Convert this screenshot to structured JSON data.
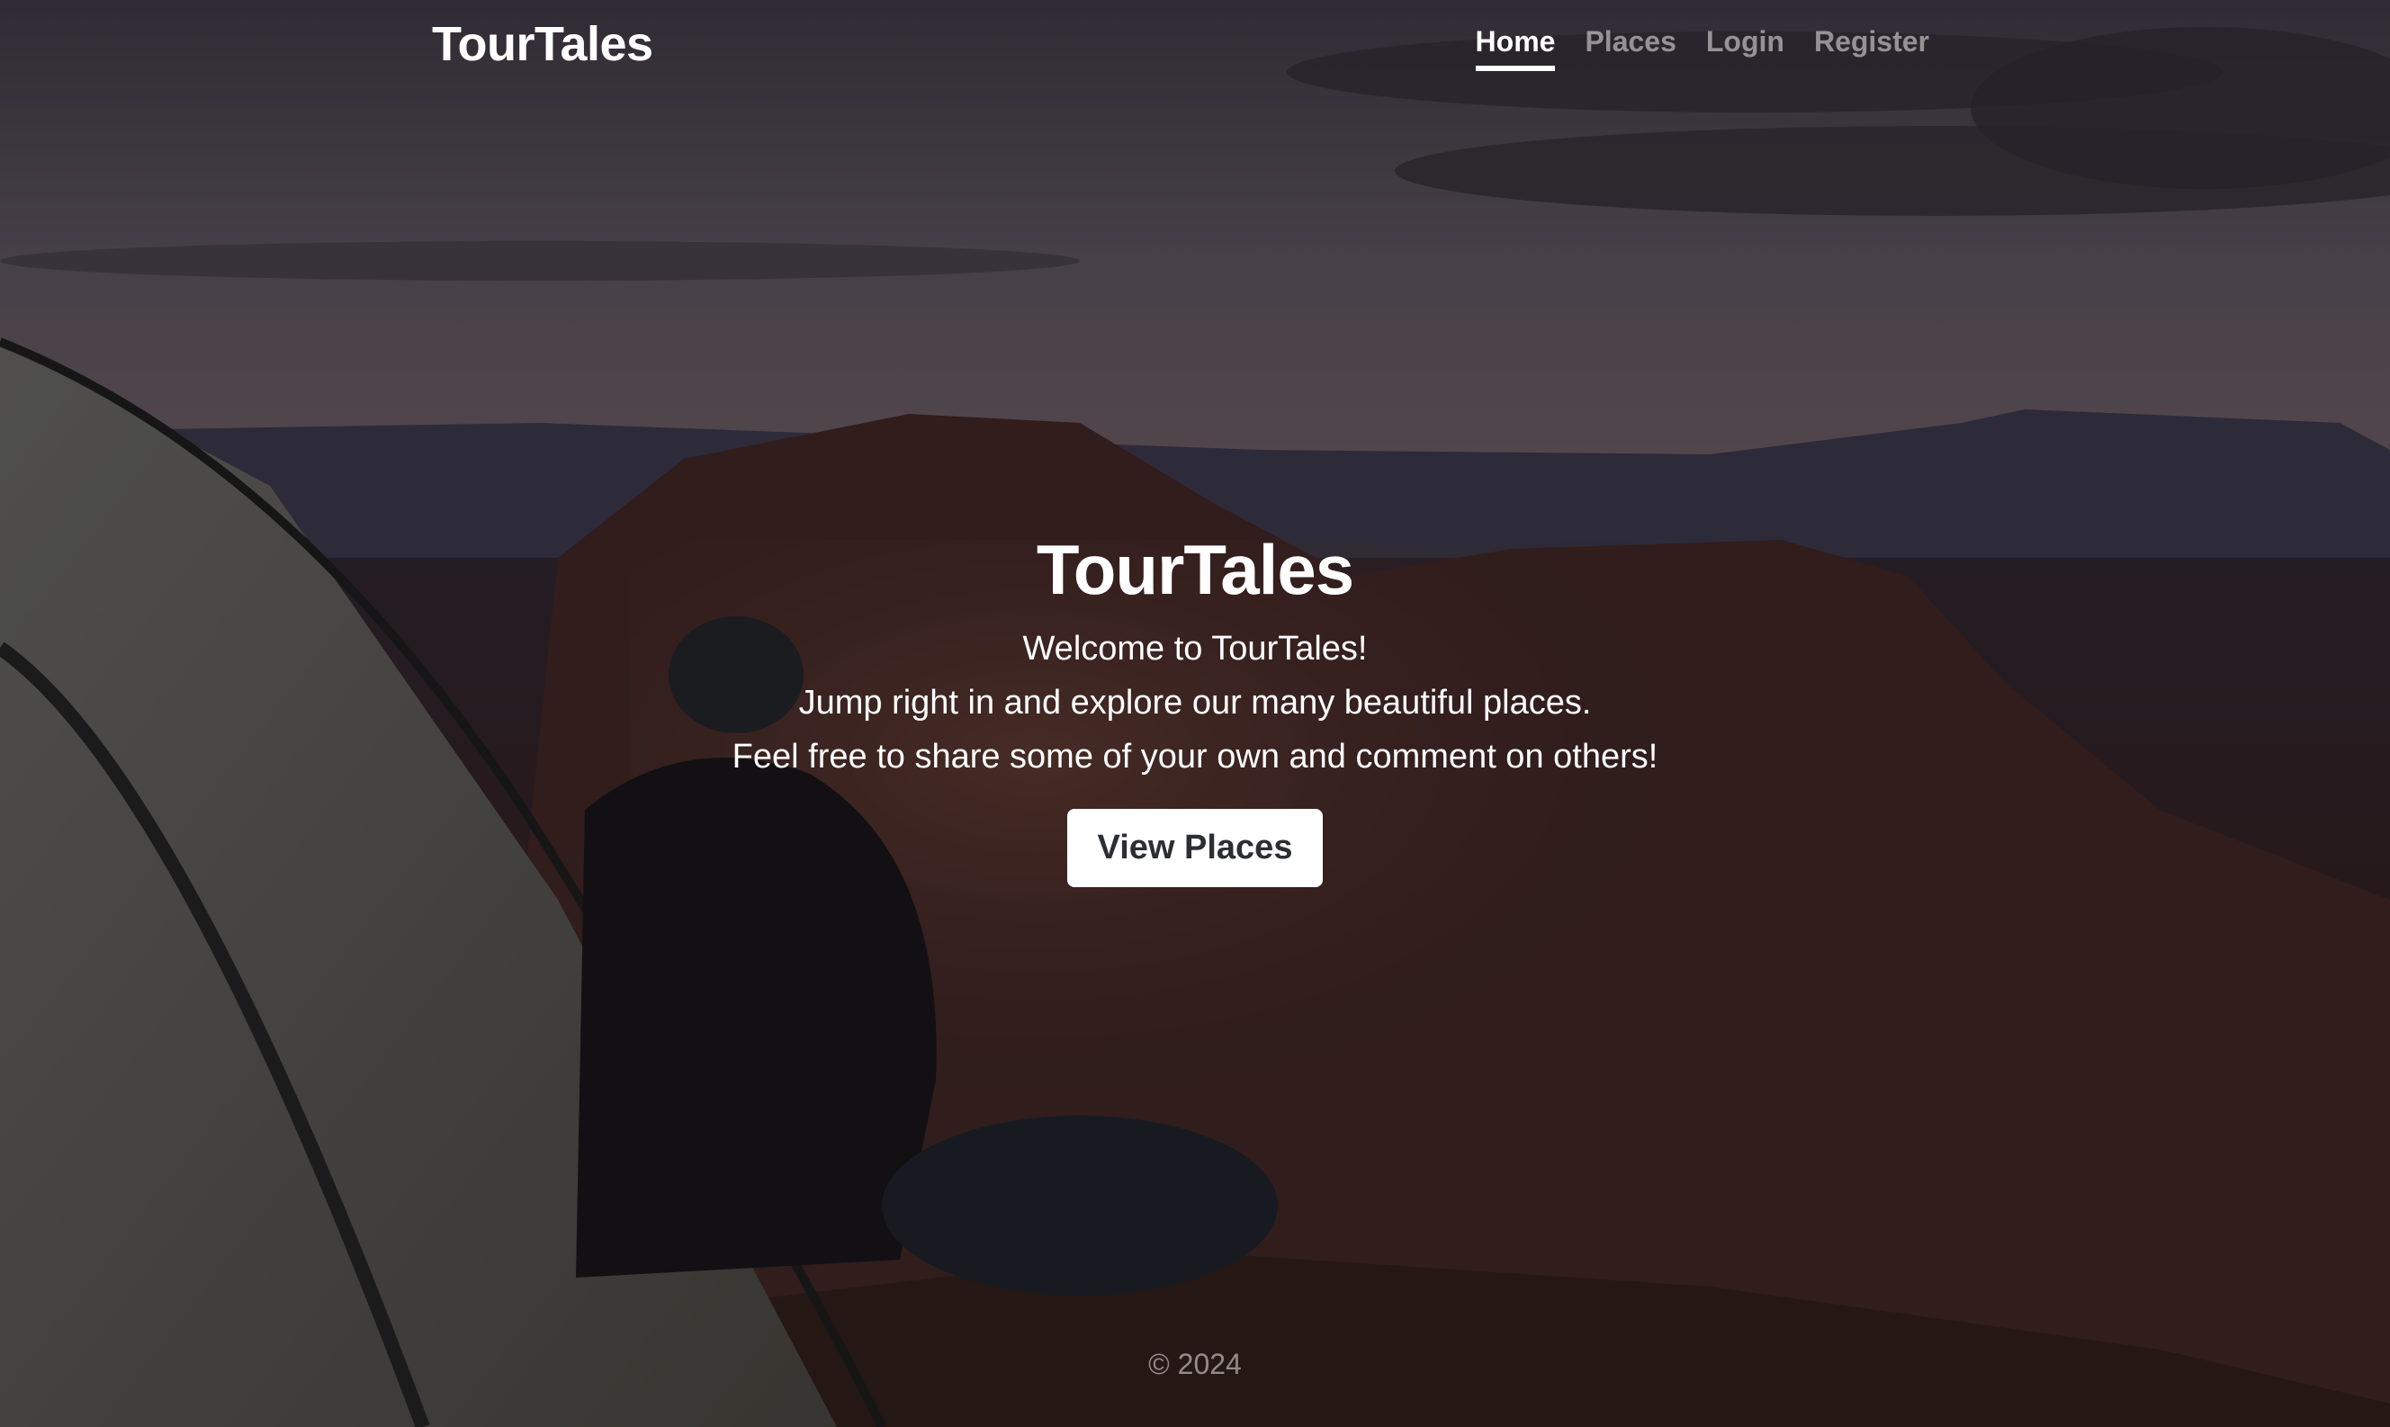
{
  "brand": {
    "name": "TourTales"
  },
  "nav": {
    "items": [
      {
        "label": "Home",
        "active": true
      },
      {
        "label": "Places",
        "active": false
      },
      {
        "label": "Login",
        "active": false
      },
      {
        "label": "Register",
        "active": false
      }
    ]
  },
  "hero": {
    "title": "TourTales",
    "lines": [
      "Welcome to TourTales!",
      "Jump right in and explore our many beautiful places.",
      "Feel free to share some of your own and comment on others!"
    ],
    "button_label": "View Places"
  },
  "footer": {
    "copyright": "© 2024"
  },
  "colors": {
    "text": "#ffffff",
    "muted_nav": "#9a9698",
    "button_bg": "#ffffff",
    "button_text": "#2b2f33"
  }
}
